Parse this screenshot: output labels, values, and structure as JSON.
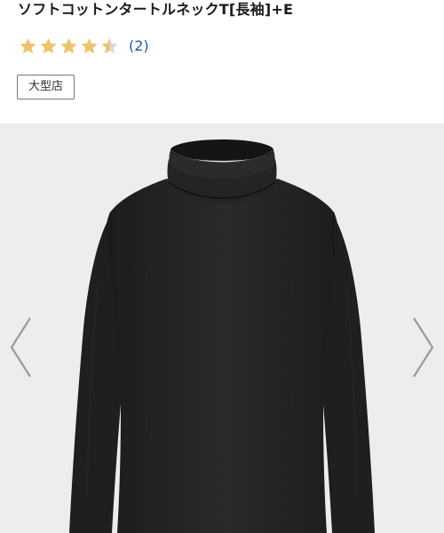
{
  "product": {
    "title": "ソフトコットンタートルネックT[長袖]+E",
    "rating": {
      "value": 4.5,
      "max": 5,
      "review_count_label": "(2)",
      "star_color": "#ecc46b",
      "star_empty_color": "#d8d8d8"
    },
    "store_badge": "大型店"
  },
  "gallery": {
    "background": "#ededed",
    "image_icon": "black-turtleneck-long-sleeve-shirt",
    "prev_icon": "chevron-left-icon",
    "next_icon": "chevron-right-icon",
    "arrow_color": "#9a9a9a"
  }
}
